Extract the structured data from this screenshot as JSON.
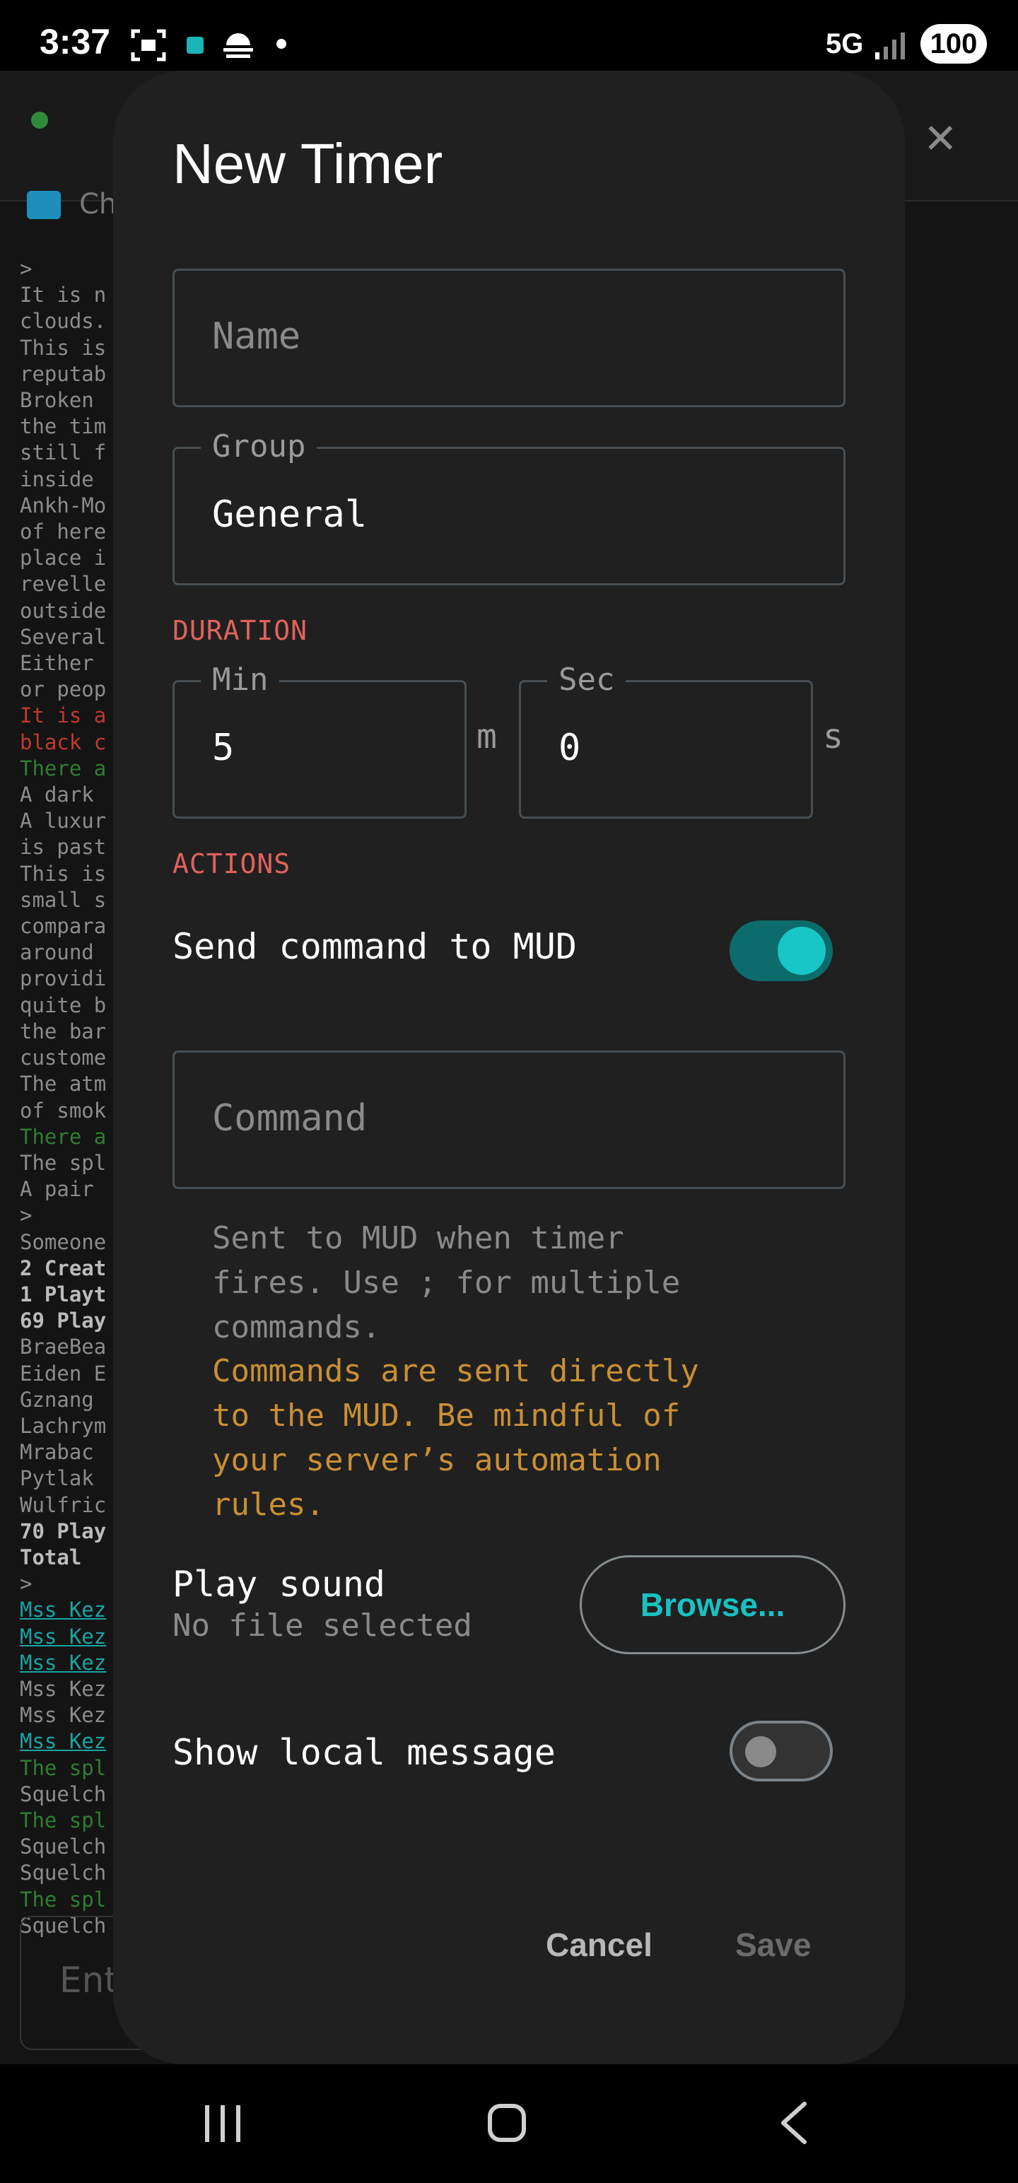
{
  "status_bar": {
    "time": "3:37",
    "network": "5G",
    "battery": "100"
  },
  "background_app": {
    "tab_label": "Ch",
    "input_placeholder": "Ent",
    "terminal_lines": [
      {
        "t": ">",
        "c": ""
      },
      {
        "t": "It is n",
        "c": ""
      },
      {
        "t": "clouds.",
        "c": ""
      },
      {
        "t": "This is",
        "c": ""
      },
      {
        "t": "reputab",
        "c": ""
      },
      {
        "t": "Broken ",
        "c": ""
      },
      {
        "t": "the tim",
        "c": ""
      },
      {
        "t": "still f",
        "c": ""
      },
      {
        "t": "inside ",
        "c": ""
      },
      {
        "t": "Ankh-Mo",
        "c": ""
      },
      {
        "t": "of here",
        "c": ""
      },
      {
        "t": "place i",
        "c": ""
      },
      {
        "t": "revelle",
        "c": ""
      },
      {
        "t": "outside",
        "c": ""
      },
      {
        "t": "Several",
        "c": ""
      },
      {
        "t": "Either ",
        "c": ""
      },
      {
        "t": "or peop",
        "c": ""
      },
      {
        "t": "It is a",
        "c": "r"
      },
      {
        "t": "black c",
        "c": "r"
      },
      {
        "t": "There a",
        "c": "g"
      },
      {
        "t": "A dark ",
        "c": ""
      },
      {
        "t": "A luxur",
        "c": ""
      },
      {
        "t": "is past",
        "c": ""
      },
      {
        "t": "This is",
        "c": ""
      },
      {
        "t": "small s",
        "c": ""
      },
      {
        "t": "compara",
        "c": ""
      },
      {
        "t": "around ",
        "c": ""
      },
      {
        "t": "providi",
        "c": ""
      },
      {
        "t": "quite b",
        "c": ""
      },
      {
        "t": "the bar",
        "c": ""
      },
      {
        "t": "custome",
        "c": ""
      },
      {
        "t": "The atm",
        "c": ""
      },
      {
        "t": "of smok",
        "c": ""
      },
      {
        "t": "There a",
        "c": "g"
      },
      {
        "t": "The spl",
        "c": ""
      },
      {
        "t": "A pair ",
        "c": ""
      },
      {
        "t": ">",
        "c": ""
      },
      {
        "t": "Someone",
        "c": ""
      },
      {
        "t": "2 Creat",
        "c": "b"
      },
      {
        "t": "1 Playt",
        "c": "b"
      },
      {
        "t": "69 Play",
        "c": "b"
      },
      {
        "t": "BraeBea",
        "c": ""
      },
      {
        "t": "Eiden E",
        "c": ""
      },
      {
        "t": "Gznang ",
        "c": ""
      },
      {
        "t": "Lachrym",
        "c": ""
      },
      {
        "t": "Mrabac ",
        "c": ""
      },
      {
        "t": "Pytlak ",
        "c": ""
      },
      {
        "t": "Wulfric",
        "c": ""
      },
      {
        "t": "70 Play",
        "c": "b"
      },
      {
        "t": "Total",
        "c": "b"
      },
      {
        "t": ">",
        "c": ""
      },
      {
        "t": "Mss Kez",
        "c": "u"
      },
      {
        "t": "Mss Kez",
        "c": "u"
      },
      {
        "t": "Mss Kez",
        "c": "u"
      },
      {
        "t": "Mss Kez",
        "c": ""
      },
      {
        "t": "Mss Kez",
        "c": ""
      },
      {
        "t": "Mss Kez",
        "c": "u"
      },
      {
        "t": "The spl",
        "c": "g"
      },
      {
        "t": "Squelch",
        "c": ""
      },
      {
        "t": "The spl",
        "c": "g"
      },
      {
        "t": "Squelch",
        "c": ""
      },
      {
        "t": "Squelch",
        "c": ""
      },
      {
        "t": "The spl",
        "c": "g"
      },
      {
        "t": "Squelch",
        "c": ""
      }
    ]
  },
  "dialog": {
    "title": "New Timer",
    "name_placeholder": "Name",
    "group_label": "Group",
    "group_value": "General",
    "duration_header": "DURATION",
    "min_label": "Min",
    "min_value": "5",
    "min_unit": "m",
    "sec_label": "Sec",
    "sec_value": "0",
    "sec_unit": "s",
    "actions_header": "ACTIONS",
    "send_command_label": "Send command to MUD",
    "send_command_on": true,
    "command_placeholder": "Command",
    "command_helper": "Sent to MUD when timer\nfires. Use ; for multiple\ncommands.",
    "command_warning": "Commands are sent directly\nto the MUD. Be mindful of\nyour server’s automation\nrules.",
    "play_sound_label": "Play sound",
    "play_sound_sub": "No file selected",
    "browse_label": "Browse...",
    "local_message_label": "Show local message",
    "local_message_on": false,
    "cancel_label": "Cancel",
    "save_label": "Save"
  },
  "colors": {
    "accent": "#19c6c6",
    "section_header": "#e0625c",
    "warning": "#c98f35"
  }
}
